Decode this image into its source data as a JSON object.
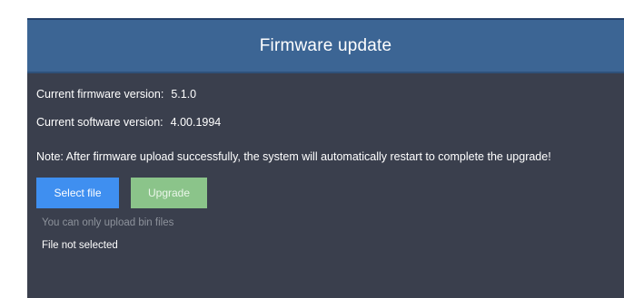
{
  "dialog": {
    "title": "Firmware update",
    "firmware_label": "Current firmware version:",
    "firmware_value": "5.1.0",
    "software_label": "Current software version:",
    "software_value": "4.00.1994",
    "note": "Note: After firmware upload successfully, the system will automatically restart to complete the upgrade!",
    "select_button": "Select file",
    "upgrade_button": "Upgrade",
    "hint": "You can only upload bin files",
    "file_status": "File not selected"
  },
  "colors": {
    "header": "#3c6594",
    "panel": "#3a3f4d",
    "select_button": "#3f8ff0",
    "upgrade_button": "#8bc48a"
  }
}
